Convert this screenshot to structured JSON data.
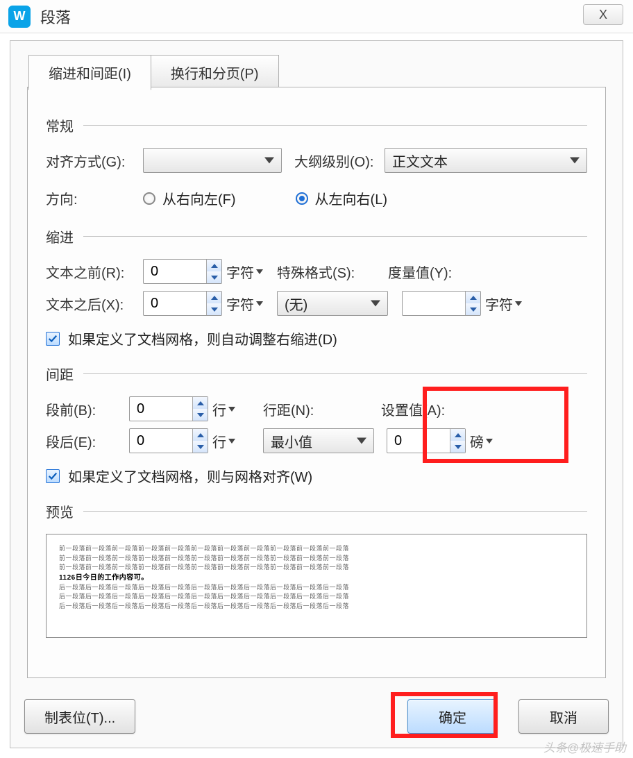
{
  "window": {
    "title": "段落",
    "app_icon_letter": "W",
    "close_glyph": "X"
  },
  "tabs": {
    "indent_spacing": "缩进和间距(I)",
    "line_page": "换行和分页(P)"
  },
  "general": {
    "heading": "常规",
    "alignment_label": "对齐方式(G):",
    "alignment_value": "",
    "outline_label": "大纲级别(O):",
    "outline_value": "正文文本",
    "direction_label": "方向:",
    "rtl_label": "从右向左(F)",
    "ltr_label": "从左向右(L)"
  },
  "indent": {
    "heading": "缩进",
    "before_text_label": "文本之前(R):",
    "before_text_value": "0",
    "after_text_label": "文本之后(X):",
    "after_text_value": "0",
    "unit_chars": "字符",
    "special_label": "特殊格式(S):",
    "special_value": "(无)",
    "measure_label": "度量值(Y):",
    "measure_value": "",
    "auto_adjust_label": "如果定义了文档网格，则自动调整右缩进(D)"
  },
  "spacing": {
    "heading": "间距",
    "before_para_label": "段前(B):",
    "before_para_value": "0",
    "after_para_label": "段后(E):",
    "after_para_value": "0",
    "unit_lines": "行",
    "line_spacing_label": "行距(N):",
    "line_spacing_value": "最小值",
    "setting_label": "设置值(A):",
    "setting_value": "0",
    "unit_points": "磅",
    "snap_grid_label": "如果定义了文档网格，则与网格对齐(W)"
  },
  "preview": {
    "heading": "预览",
    "sample_repeat": "前一段落前一段落前一段落前一段落前一段落前一段落前一段落前一段落前一段落前一段落前一段落",
    "sample_content": "1126日今日的工作内容可。",
    "sample_after": "后一段落后一段落后一段落后一段落后一段落后一段落后一段落后一段落后一段落后一段落后一段落"
  },
  "buttons": {
    "tabs_btn": "制表位(T)...",
    "ok": "确定",
    "cancel": "取消"
  },
  "watermark": "头条@极速手助"
}
